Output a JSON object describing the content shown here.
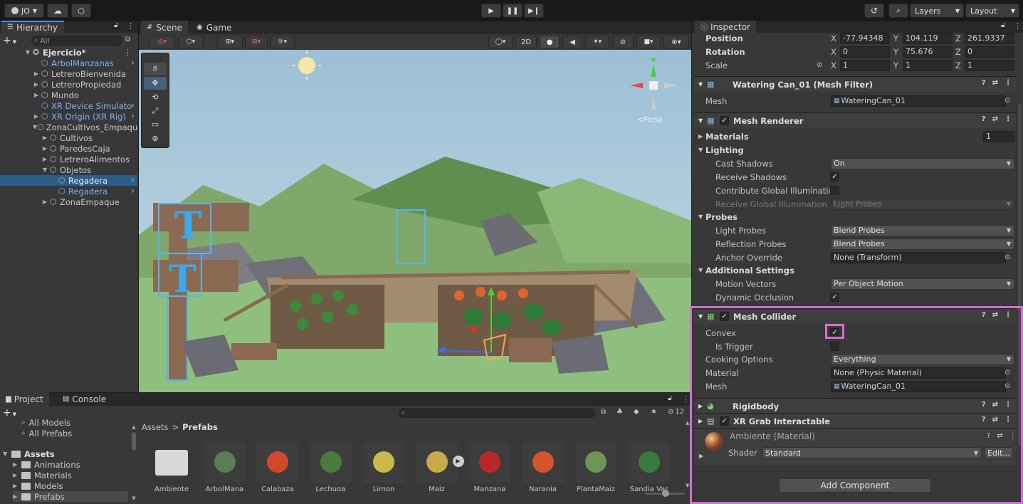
{
  "toolbar": {
    "account_label": "JO",
    "layers_label": "Layers",
    "layout_label": "Layout"
  },
  "hierarchy": {
    "tab_label": "Hierarchy",
    "search_placeholder": "All",
    "items": [
      {
        "label": "Ejercicio*",
        "indent": 0,
        "icon": "unity-scene-icon",
        "expanded": true,
        "bold": true
      },
      {
        "label": "ArbolManzanas",
        "indent": 1,
        "prefab": true
      },
      {
        "label": "LetreroBienvenida",
        "indent": 1,
        "collapsed": true
      },
      {
        "label": "LetreroPropiedad",
        "indent": 1,
        "collapsed": true
      },
      {
        "label": "Mundo",
        "indent": 1,
        "collapsed": true
      },
      {
        "label": "XR Device Simulato",
        "indent": 1,
        "prefab": true
      },
      {
        "label": "XR Origin (XR Rig)",
        "indent": 1,
        "prefab": true,
        "collapsed": true
      },
      {
        "label": "ZonaCultivos_Empaqu",
        "indent": 1,
        "expanded": true
      },
      {
        "label": "Cultivos",
        "indent": 2,
        "collapsed": true
      },
      {
        "label": "ParedesCaja",
        "indent": 2,
        "collapsed": true
      },
      {
        "label": "LetreroAlimentos",
        "indent": 2,
        "collapsed": true
      },
      {
        "label": "Objetos",
        "indent": 2,
        "expanded": true
      },
      {
        "label": "Regadera",
        "indent": 3,
        "prefab": true,
        "selected": true
      },
      {
        "label": "Regadera",
        "indent": 3,
        "prefab": true
      },
      {
        "label": "ZonaEmpaque",
        "indent": 2,
        "collapsed": true
      }
    ]
  },
  "scene": {
    "tab_scene": "Scene",
    "tab_game": "Game",
    "mode_2d": "2D",
    "persp_label": "<Persp"
  },
  "project": {
    "tab_project": "Project",
    "tab_console": "Console",
    "search_count": "12",
    "tree": [
      {
        "label": "All Models",
        "type": "search"
      },
      {
        "label": "All Prefabs",
        "type": "search"
      },
      {
        "label": "Assets",
        "type": "folder",
        "bold": true
      },
      {
        "label": "Animations",
        "type": "folder"
      },
      {
        "label": "Materials",
        "type": "folder"
      },
      {
        "label": "Models",
        "type": "folder"
      },
      {
        "label": "Prefabs",
        "type": "folder",
        "selected": true
      }
    ],
    "breadcrumb_root": "Assets",
    "breadcrumb_sep": ">",
    "breadcrumb_current": "Prefabs",
    "assets": [
      {
        "name": "Ambiente",
        "color": "#d8d8d8"
      },
      {
        "name": "ArbolMana",
        "color": "#5a7d55"
      },
      {
        "name": "Calabaza",
        "color": "#d0492c"
      },
      {
        "name": "Lechuga",
        "color": "#4a7a3c"
      },
      {
        "name": "Limon",
        "color": "#c9b949"
      },
      {
        "name": "Maiz",
        "color": "#c9a94a"
      },
      {
        "name": "Manzana",
        "color": "#b8282b"
      },
      {
        "name": "Naranja",
        "color": "#d4552a"
      },
      {
        "name": "PlantaMaiz",
        "color": "#6d9654"
      },
      {
        "name": "Sandia Var",
        "color": "#3a7a40"
      }
    ]
  },
  "inspector": {
    "tab_label": "Inspector",
    "transform": {
      "position_label": "Position",
      "rotation_label": "Rotation",
      "scale_label": "Scale",
      "axis_x": "X",
      "axis_y": "Y",
      "axis_z": "Z",
      "position": [
        "-77.94348",
        "104.119",
        "261.9337"
      ],
      "rotation": [
        "0",
        "75.676",
        "0"
      ],
      "scale": [
        "1",
        "1",
        "1"
      ]
    },
    "mesh_filter": {
      "title": "Watering Can_01 (Mesh Filter)",
      "mesh_label": "Mesh",
      "mesh_value": "WateringCan_01"
    },
    "mesh_renderer": {
      "title": "Mesh Renderer",
      "materials_label": "Materials",
      "materials_count": "1",
      "lighting_label": "Lighting",
      "cast_shadows_label": "Cast Shadows",
      "cast_shadows_value": "On",
      "receive_shadows_label": "Receive Shadows",
      "contribute_gi_label": "Contribute Global Illumination",
      "receive_gi_label": "Receive Global Illumination",
      "receive_gi_value": "Light Probes",
      "probes_label": "Probes",
      "light_probes_label": "Light Probes",
      "light_probes_value": "Blend Probes",
      "reflection_probes_label": "Reflection Probes",
      "reflection_probes_value": "Blend Probes",
      "anchor_override_label": "Anchor Override",
      "anchor_override_value": "None (Transform)",
      "additional_label": "Additional Settings",
      "motion_vectors_label": "Motion Vectors",
      "motion_vectors_value": "Per Object Motion",
      "dynamic_occlusion_label": "Dynamic Occlusion"
    },
    "mesh_collider": {
      "title": "Mesh Collider",
      "convex_label": "Convex",
      "is_trigger_label": "Is Trigger",
      "cooking_label": "Cooking Options",
      "cooking_value": "Everything",
      "material_label": "Material",
      "material_value": "None (Physic Material)",
      "mesh_label": "Mesh",
      "mesh_value": "WateringCan_01"
    },
    "rigidbody_title": "Rigidbody",
    "xr_grab_title": "XR Grab Interactable",
    "material": {
      "title": "Ambiente (Material)",
      "shader_label": "Shader",
      "shader_value": "Standard",
      "edit_label": "Edit..."
    },
    "add_component_label": "Add Component"
  },
  "colors": {
    "highlight": "#d66fd1",
    "selection": "#2c5d87",
    "prefab_text": "#7eb1f2"
  }
}
